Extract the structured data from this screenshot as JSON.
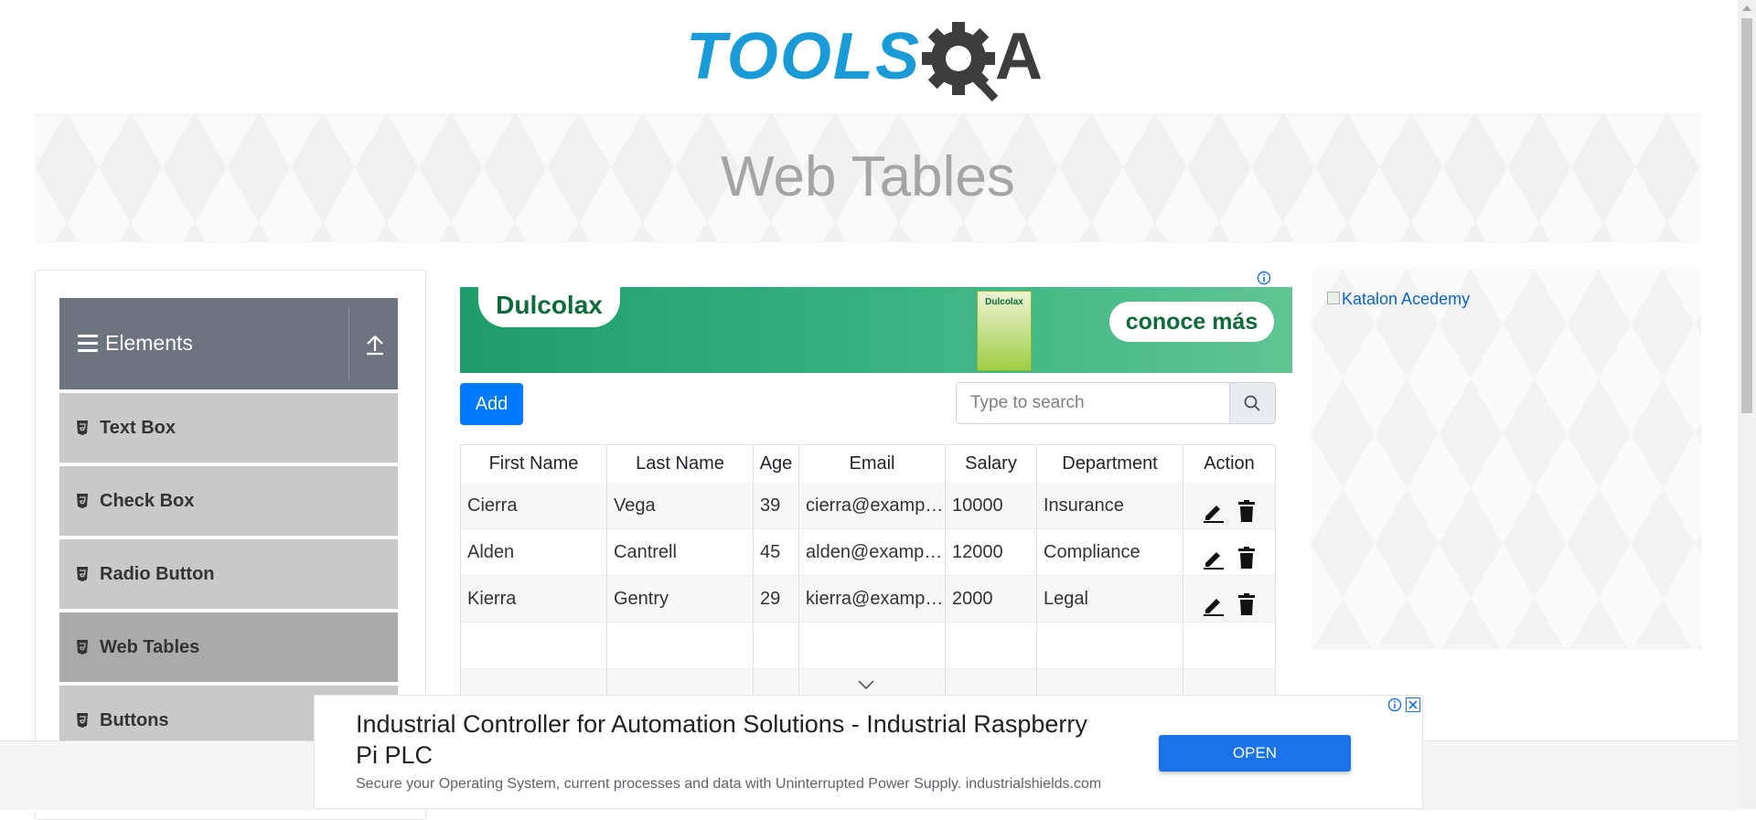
{
  "logo": {
    "text_left": "TOOLS",
    "text_right": "QA"
  },
  "page_title": "Web Tables",
  "sidebar": {
    "group_title": "Elements",
    "items": [
      {
        "label": "Text Box",
        "active": false
      },
      {
        "label": "Check Box",
        "active": false
      },
      {
        "label": "Radio Button",
        "active": false
      },
      {
        "label": "Web Tables",
        "active": true
      },
      {
        "label": "Buttons",
        "active": false
      }
    ]
  },
  "top_ad": {
    "brand": "Dulcolax",
    "pack_label": "Dulcolax",
    "cta": "conoce más"
  },
  "toolbar": {
    "add_label": "Add",
    "search_placeholder": "Type to search"
  },
  "table": {
    "columns": [
      "First Name",
      "Last Name",
      "Age",
      "Email",
      "Salary",
      "Department",
      "Action"
    ],
    "rows": [
      [
        "Cierra",
        "Vega",
        "39",
        "cierra@example.com",
        "10000",
        "Insurance"
      ],
      [
        "Alden",
        "Cantrell",
        "45",
        "alden@example.com",
        "12000",
        "Compliance"
      ],
      [
        "Kierra",
        "Gentry",
        "29",
        "kierra@example.com",
        "2000",
        "Legal"
      ]
    ]
  },
  "right_ad": {
    "alt_text": "Katalon Acedemy"
  },
  "bottom_ad": {
    "headline": "Industrial Controller for Automation Solutions - Industrial Raspberry Pi PLC",
    "description": "Secure your Operating System, current processes and data with Uninterrupted Power Supply. industrialshields.com",
    "cta": "OPEN"
  },
  "colors": {
    "accent": "#007bff",
    "logo_blue": "#1a9ad6",
    "logo_dark": "#3d3d3d",
    "menu_header": "#6c757d"
  }
}
